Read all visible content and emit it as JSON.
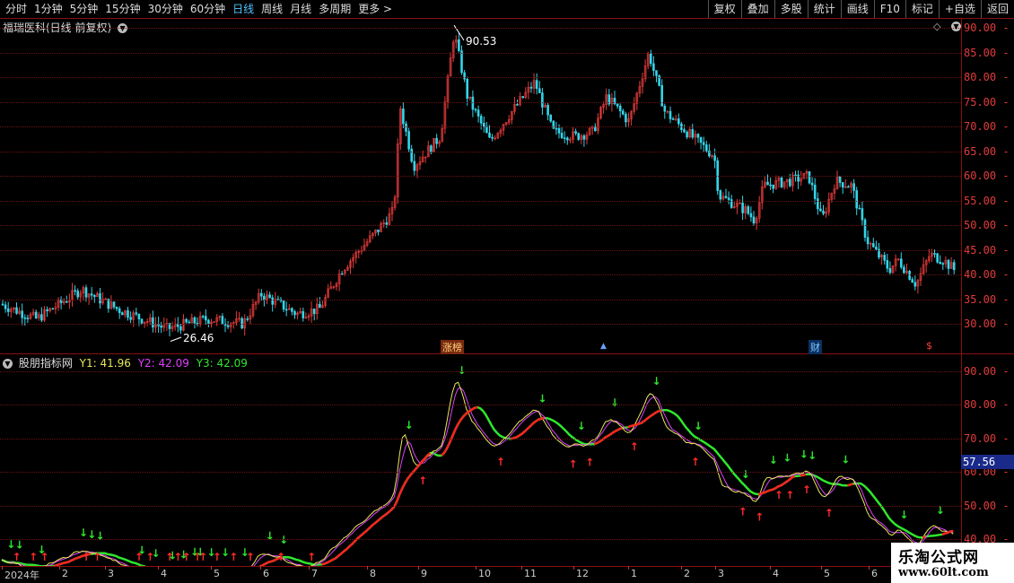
{
  "toolbar": {
    "tabs": [
      {
        "label": "分时",
        "active": false
      },
      {
        "label": "1分钟",
        "active": false
      },
      {
        "label": "5分钟",
        "active": false
      },
      {
        "label": "15分钟",
        "active": false
      },
      {
        "label": "30分钟",
        "active": false
      },
      {
        "label": "60分钟",
        "active": false
      },
      {
        "label": "日线",
        "active": true
      },
      {
        "label": "周线",
        "active": false
      },
      {
        "label": "月线",
        "active": false
      },
      {
        "label": "多周期",
        "active": false
      },
      {
        "label": "更多 >",
        "active": false
      }
    ],
    "right_buttons": [
      "复权",
      "叠加",
      "多股",
      "统计",
      "画线",
      "F10",
      "标记",
      "+自选",
      "返回"
    ]
  },
  "main_panel": {
    "title": "福瑞医科(日线 前复权)",
    "price_axis": [
      "90.00",
      "85.00",
      "80.00",
      "75.00",
      "70.00",
      "65.00",
      "60.00",
      "55.00",
      "50.00",
      "45.00",
      "40.00",
      "35.00",
      "30.00"
    ],
    "high_label": "90.53",
    "low_label": "26.46",
    "markers": {
      "zhangbang": "涨榜",
      "cai": "财",
      "s": "$"
    }
  },
  "indicator_panel": {
    "title": "股朋指标网",
    "y1_label": "Y1: 41.96",
    "y2_label": "Y2: 42.09",
    "y3_label": "Y3: 42.09",
    "axis": [
      "90.00",
      "80.00",
      "70.00",
      "60.00",
      "50.00",
      "40.00"
    ],
    "current_value": "57.56"
  },
  "date_axis": [
    "2024年",
    "2",
    "3",
    "4",
    "5",
    "6",
    "7",
    "8",
    "9",
    "10",
    "11",
    "12",
    "1",
    "2",
    "3",
    "4",
    "5",
    "6"
  ],
  "watermark": {
    "title": "乐淘公式网",
    "url": "www.60lt.com"
  },
  "colors": {
    "up": "#e23b3b",
    "down": "#35d4e8",
    "y1": "#e8e85a",
    "y2": "#e040fb",
    "y3": "#2ee62e"
  },
  "chart_data": {
    "type": "candlestick",
    "title": "福瑞医科(日线 前复权)",
    "x_months": [
      "2024-01",
      "2024-02",
      "2024-03",
      "2024-04",
      "2024-05",
      "2024-06",
      "2024-07",
      "2024-08",
      "2024-09",
      "2024-10",
      "2024-11",
      "2024-12",
      "2025-01",
      "2025-02",
      "2025-03",
      "2025-04",
      "2025-05",
      "2025-06"
    ],
    "close_monthly_approx": [
      33,
      31,
      34,
      30,
      29,
      33,
      31,
      45,
      68,
      75,
      70,
      68,
      80,
      67,
      56,
      58,
      56,
      42
    ],
    "ylim": [
      26,
      92
    ],
    "high": 90.53,
    "low": 26.46
  }
}
